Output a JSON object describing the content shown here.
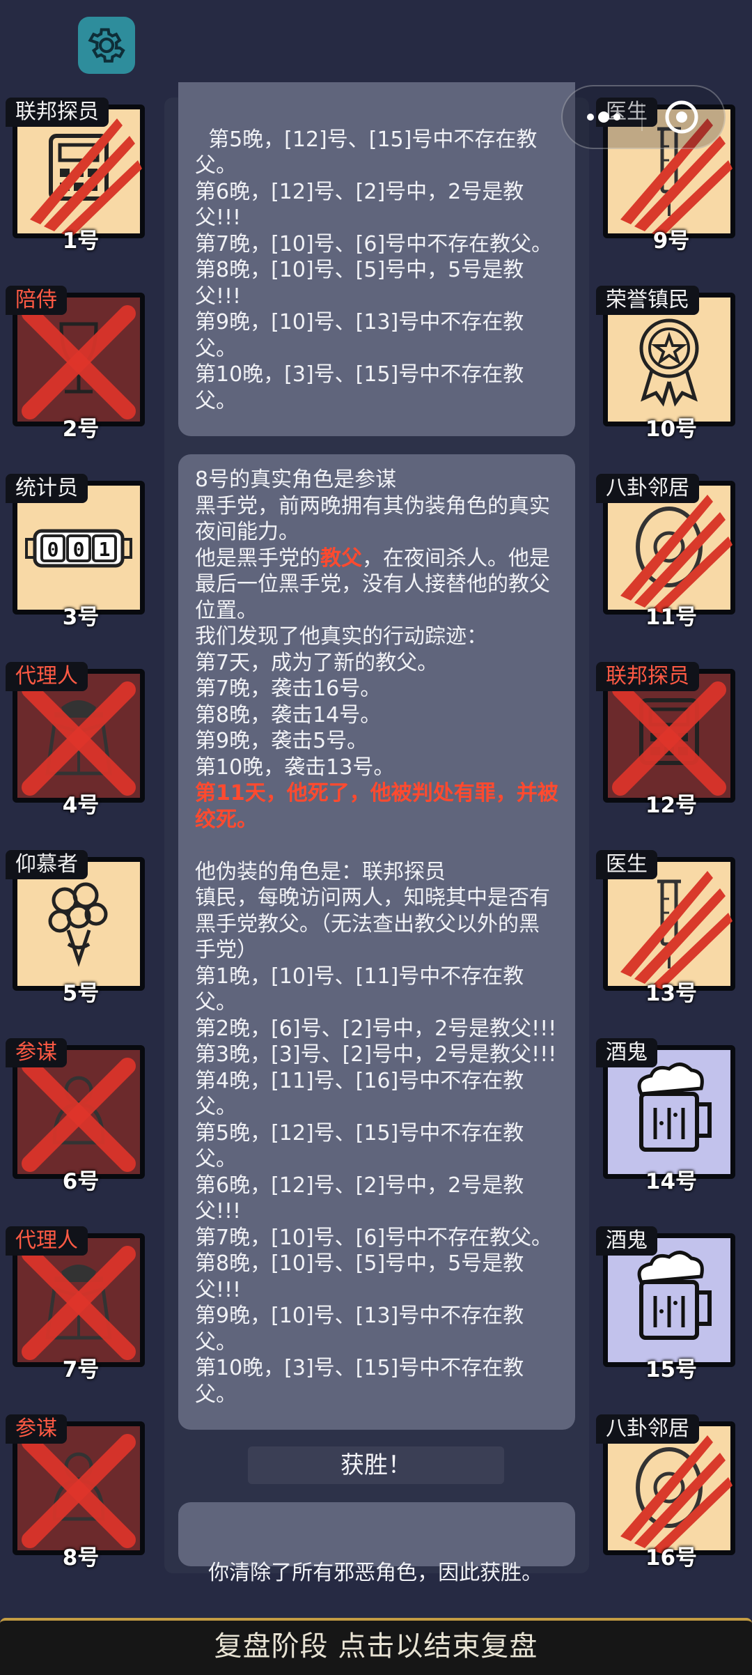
{
  "header": {
    "settings_icon": "gear-icon",
    "capsule_icons": [
      "more-icon",
      "close-target-icon"
    ]
  },
  "players_left": [
    {
      "role": "联邦探员",
      "number": "1号",
      "status": "clawed",
      "icon": "calculator-icon"
    },
    {
      "role": "陪侍",
      "number": "2号",
      "status": "dead",
      "icon": "wine-glass-icon"
    },
    {
      "role": "统计员",
      "number": "3号",
      "status": "alive",
      "icon": "counter-icon",
      "counter": "001"
    },
    {
      "role": "代理人",
      "number": "4号",
      "status": "dead",
      "icon": "trench-coat-icon"
    },
    {
      "role": "仰慕者",
      "number": "5号",
      "status": "alive",
      "icon": "bouquet-icon"
    },
    {
      "role": "参谋",
      "number": "6号",
      "status": "dead",
      "icon": "advisor-icon"
    },
    {
      "role": "代理人",
      "number": "7号",
      "status": "dead",
      "icon": "trench-coat-icon"
    },
    {
      "role": "参谋",
      "number": "8号",
      "status": "dead",
      "icon": "advisor-icon"
    }
  ],
  "players_right": [
    {
      "role": "医生",
      "number": "9号",
      "status": "clawed",
      "icon": "syringe-icon"
    },
    {
      "role": "荣誉镇民",
      "number": "10号",
      "status": "alive",
      "icon": "medal-icon"
    },
    {
      "role": "八卦邻居",
      "number": "11号",
      "status": "clawed",
      "icon": "gossip-icon"
    },
    {
      "role": "联邦探员",
      "number": "12号",
      "status": "dead",
      "icon": "calculator-icon"
    },
    {
      "role": "医生",
      "number": "13号",
      "status": "clawed",
      "icon": "syringe-icon"
    },
    {
      "role": "酒鬼",
      "number": "14号",
      "status": "drunk",
      "icon": "beer-mug-icon"
    },
    {
      "role": "酒鬼",
      "number": "15号",
      "status": "drunk",
      "icon": "beer-mug-icon"
    },
    {
      "role": "八卦邻居",
      "number": "16号",
      "status": "clawed",
      "icon": "gossip-icon"
    }
  ],
  "log_top": "第5晚，[12]号、[15]号中不存在教父。\n第6晚，[12]号、[2]号中，2号是教父!!!\n第7晚，[10]号、[6]号中不存在教父。\n第8晚，[10]号、[5]号中，5号是教父!!!\n第9晚，[10]号、[13]号中不存在教父。\n第10晚，[3]号、[15]号中不存在教父。",
  "log_main": {
    "intro": "8号的真实角色是参谋\n黑手党，前两晚拥有其伪装角色的真实夜间能力。\n他是黑手党的",
    "godfather": "教父",
    "intro_after": "，在夜间杀人。他是最后一位黑手党，没有人接替他的教父位置。\n我们发现了他真实的行动踪迹：\n第7天，成为了新的教父。\n第7晚，袭击16号。\n第8晚，袭击14号。\n第9晚，袭击5号。\n第10晚，袭击13号。",
    "death": "第11天，他死了，他被判处有罪，并被绞死。",
    "disguise": "他伪装的角色是：联邦探员\n镇民，每晚访问两人，知晓其中是否有黑手党教父。（无法查出教父以外的黑手党）\n第1晚，[10]号、[11]号中不存在教父。\n第2晚，[6]号、[2]号中，2号是教父!!!\n第3晚，[3]号、[2]号中，2号是教父!!!\n第4晚，[11]号、[16]号中不存在教父。\n第5晚，[12]号、[15]号中不存在教父。\n第6晚，[12]号、[2]号中，2号是教父!!!\n第7晚，[10]号、[6]号中不存在教父。\n第8晚，[10]号、[5]号中，5号是教父!!!\n第9晚，[10]号、[13]号中不存在教父。\n第10晚，[3]号、[15]号中不存在教父。"
  },
  "result": {
    "title": "获胜！",
    "text": "你清除了所有邪恶角色，因此获胜。"
  },
  "footer": {
    "label": "复盘阶段 点击以结束复盘"
  },
  "colors": {
    "background": "#262a43",
    "tile_alive": "#f8d9a6",
    "tile_dead": "#6c2a2c",
    "tile_drunk": "#c2c2ec",
    "highlight": "#ff4a2f",
    "footer_border": "#c39c43"
  }
}
